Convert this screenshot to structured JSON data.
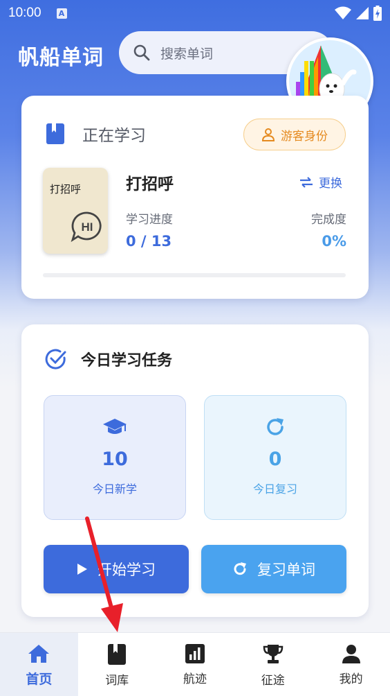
{
  "status_bar": {
    "time": "10:00",
    "notification_letter": "A"
  },
  "header": {
    "title": "帆船单词",
    "search_placeholder": "搜索单词",
    "avatar_icon": "sailboat-mascot-icon"
  },
  "study_card": {
    "heading": "正在学习",
    "guest_badge": "游客身份",
    "book": {
      "cover_text": "打招呼",
      "cover_badge": "HI",
      "name": "打招呼"
    },
    "switch_label": "更换",
    "progress_label": "学习进度",
    "progress_value": "0 / 13",
    "completion_label": "完成度",
    "completion_value": "0%",
    "progress_fraction": 0
  },
  "task_card": {
    "heading": "今日学习任务",
    "new_words": {
      "count": "10",
      "label": "今日新学",
      "icon": "graduation-cap-icon"
    },
    "review_words": {
      "count": "0",
      "label": "今日复习",
      "icon": "refresh-icon"
    },
    "start_button": "开始学习",
    "review_button": "复习单词"
  },
  "bottom_nav": [
    {
      "label": "首页",
      "icon": "home-icon",
      "active": true
    },
    {
      "label": "词库",
      "icon": "book-icon",
      "active": false
    },
    {
      "label": "航迹",
      "icon": "bar-chart-icon",
      "active": false
    },
    {
      "label": "征途",
      "icon": "trophy-icon",
      "active": false
    },
    {
      "label": "我的",
      "icon": "person-icon",
      "active": false
    }
  ],
  "colors": {
    "primary": "#3d6bdc",
    "secondary": "#4aa3ef",
    "guest_accent": "#e58a1f",
    "annotation_arrow": "#e8202a"
  }
}
